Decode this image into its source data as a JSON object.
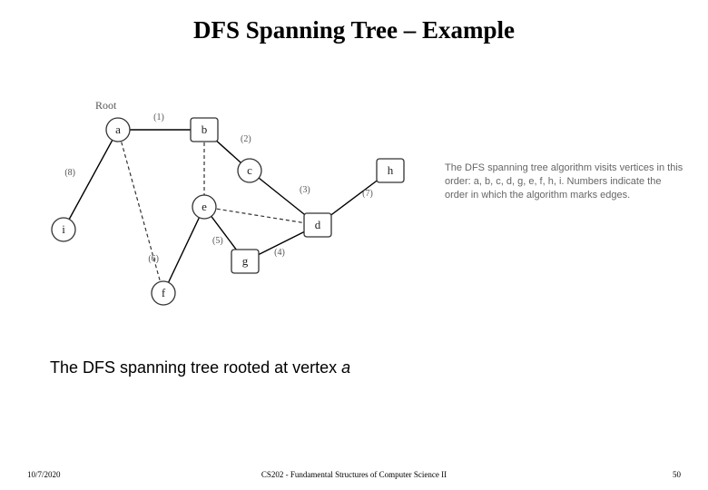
{
  "title": "DFS Spanning Tree – Example",
  "root_label": "Root",
  "nodes": {
    "a": "a",
    "b": "b",
    "c": "c",
    "d": "d",
    "e": "e",
    "f": "f",
    "g": "g",
    "h": "h",
    "i": "i"
  },
  "edge_labels": {
    "ab": "(1)",
    "bc": "(2)",
    "cd": "(3)",
    "dg": "(4)",
    "ge": "(5)",
    "ef": "(6)",
    "dh": "(7)",
    "ai": "(8)"
  },
  "side_text": "The DFS spanning tree algorithm visits vertices in this order: a, b, c, d, g, e, f, h, i. Numbers indicate the order in which the algorithm marks edges.",
  "caption_prefix": "The DFS spanning tree rooted at vertex ",
  "caption_vertex": "a",
  "footer": {
    "date": "10/7/2020",
    "center": "CS202 - Fundamental Structures of Computer Science II",
    "page": "50"
  },
  "chart_data": {
    "type": "graph",
    "nodes": [
      "a",
      "b",
      "c",
      "d",
      "e",
      "f",
      "g",
      "h",
      "i"
    ],
    "root": "a",
    "tree_edges": [
      {
        "from": "a",
        "to": "b",
        "order": 1
      },
      {
        "from": "b",
        "to": "c",
        "order": 2
      },
      {
        "from": "c",
        "to": "d",
        "order": 3
      },
      {
        "from": "d",
        "to": "g",
        "order": 4
      },
      {
        "from": "g",
        "to": "e",
        "order": 5
      },
      {
        "from": "e",
        "to": "f",
        "order": 6
      },
      {
        "from": "d",
        "to": "h",
        "order": 7
      },
      {
        "from": "a",
        "to": "i",
        "order": 8
      }
    ],
    "back_edges": [
      {
        "from": "b",
        "to": "e"
      },
      {
        "from": "a",
        "to": "f"
      },
      {
        "from": "e",
        "to": "d"
      }
    ],
    "visit_order": [
      "a",
      "b",
      "c",
      "d",
      "g",
      "e",
      "f",
      "h",
      "i"
    ]
  }
}
